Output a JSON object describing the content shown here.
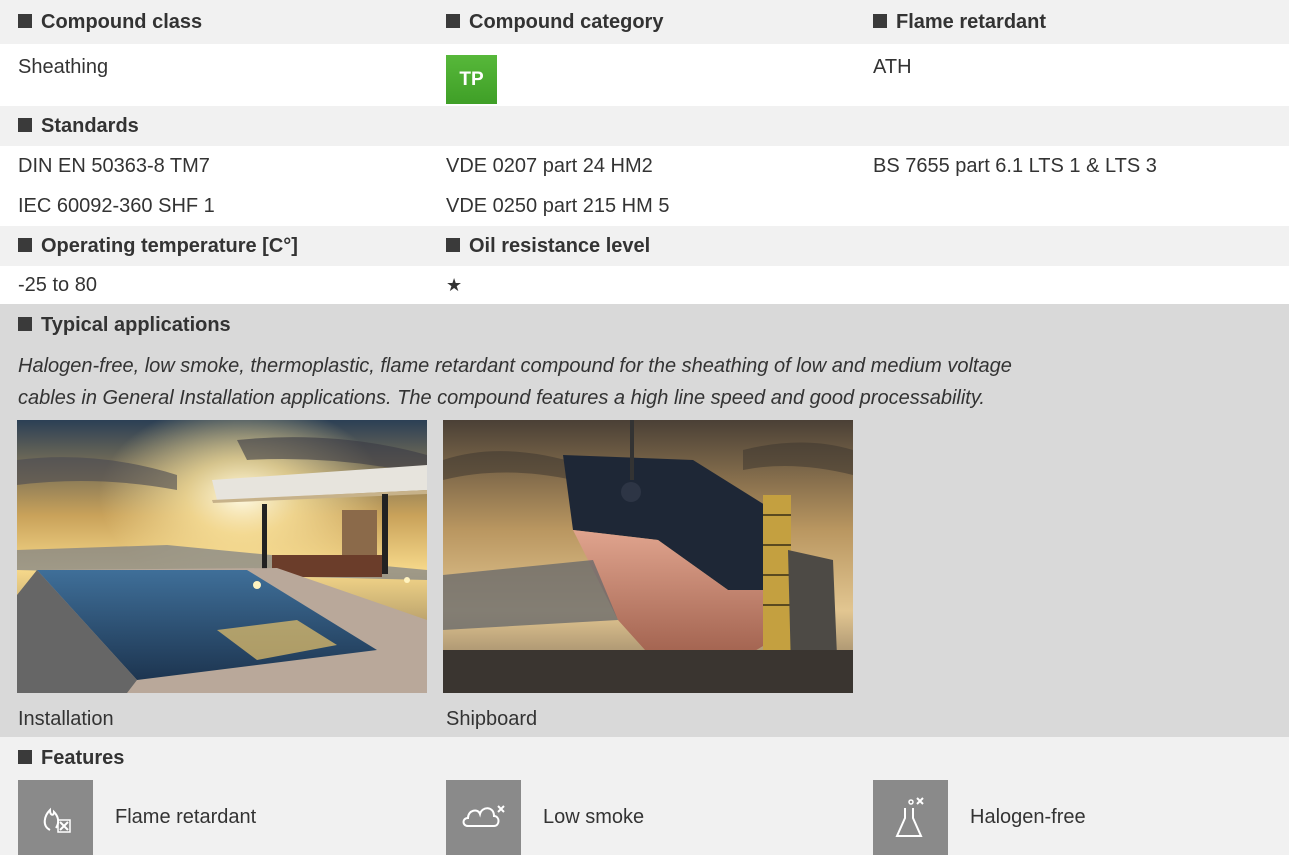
{
  "compound_class": {
    "label": "Compound class",
    "value": "Sheathing"
  },
  "compound_category": {
    "label": "Compound category",
    "badge": "TP",
    "badge_color": "#4caf32"
  },
  "flame_retardant": {
    "label": "Flame retardant",
    "value": "ATH"
  },
  "standards": {
    "label": "Standards",
    "items": [
      "DIN EN 50363-8 TM7",
      "VDE 0207 part 24 HM2",
      "BS 7655 part 6.1 LTS 1 & LTS 3",
      "IEC 60092-360 SHF 1",
      "VDE 0250 part 215 HM 5"
    ]
  },
  "operating_temperature": {
    "label": "Operating temperature [C°]",
    "value": "-25 to 80"
  },
  "oil_resistance": {
    "label": "Oil resistance level",
    "value": "★"
  },
  "typical_applications": {
    "label": "Typical applications",
    "description_line1": "Halogen-free, low smoke, thermoplastic, flame retardant compound for the sheathing of low and medium voltage",
    "description_line2": "cables in General Installation applications. The compound features a high line speed and good processability.",
    "images": [
      {
        "caption": "Installation",
        "icon": "installation-photo"
      },
      {
        "caption": "Shipboard",
        "icon": "shipboard-photo"
      }
    ]
  },
  "features": {
    "label": "Features",
    "items": [
      {
        "label": "Flame retardant",
        "icon": "flame-retardant-icon"
      },
      {
        "label": "Low smoke",
        "icon": "low-smoke-icon"
      },
      {
        "label": "Halogen-free",
        "icon": "halogen-free-icon"
      }
    ]
  },
  "colors": {
    "header_gray": "#f1f1f1",
    "apps_gray": "#d9d9d9",
    "icon_gray": "#8a8a8a",
    "text": "#333333"
  }
}
